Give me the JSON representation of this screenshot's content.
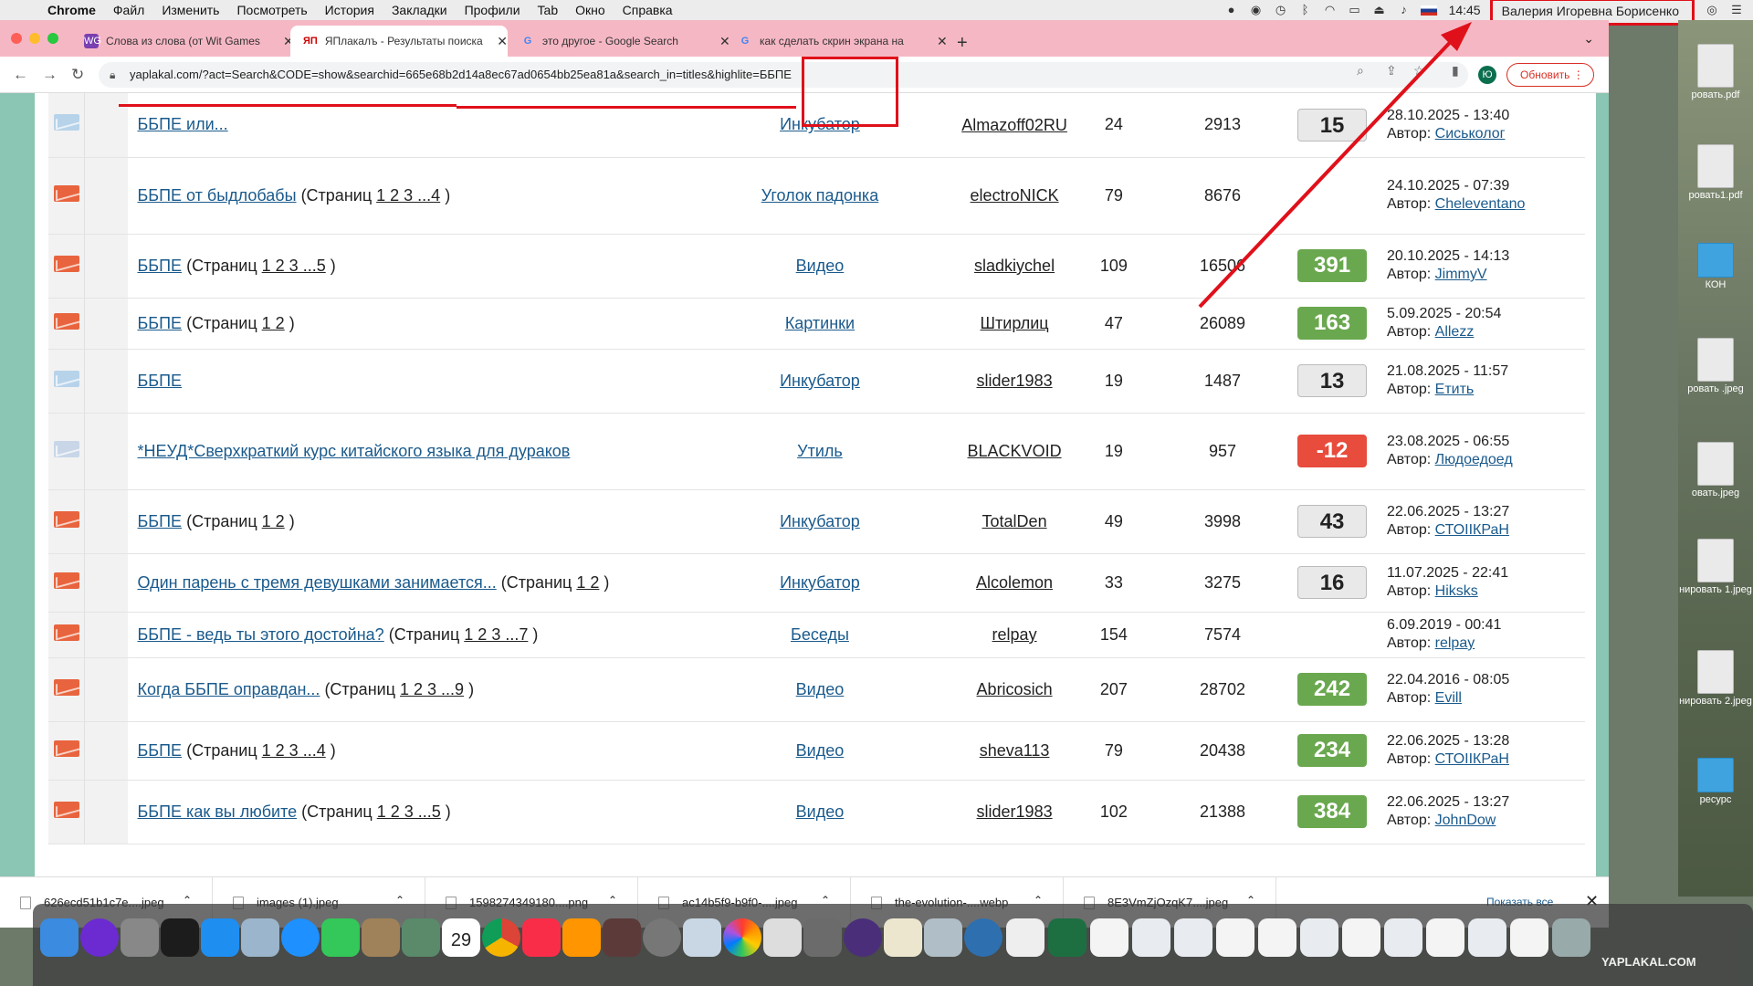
{
  "menubar": {
    "app": "Chrome",
    "items": [
      "Файл",
      "Изменить",
      "Посмотреть",
      "История",
      "Закладки",
      "Профили",
      "Tab",
      "Окно",
      "Справка"
    ],
    "clock": "14:45",
    "user": "Валерия Игоревна Борисенко"
  },
  "tabs": [
    {
      "title": "Слова из слова (от Wit Games",
      "favicon": "WG"
    },
    {
      "title": "ЯПлакалъ - Результаты поиска",
      "favicon": "ЯП"
    },
    {
      "title": "это другое - Google Search",
      "favicon": "G"
    },
    {
      "title": "как сделать скрин экрана на",
      "favicon": "G"
    }
  ],
  "toolbar": {
    "url": "yaplakal.com/?act=Search&CODE=show&searchid=665e68b2d14a8ec67ad0654bb25ea81a&search_in=titles&highlite=ББПЕ",
    "update_label": "Обновить",
    "profile_initial": "Ю"
  },
  "results": [
    {
      "icon": "env-blue",
      "title": "ББПЕ или...",
      "pages": "",
      "forum": "Инкубатор",
      "author": "Almazoff02RU",
      "replies": "24",
      "views": "2913",
      "score": "15",
      "score_style": "grey",
      "date": "28.10.2025 - 13:40",
      "last_label": "Автор:",
      "last_author": "Сиськолог"
    },
    {
      "icon": "env-red",
      "title": "ББПЕ от быдлобабы",
      "pages": "1 2 3 ...4",
      "forum": "Уголок падонка",
      "author": "electroNICK",
      "replies": "79",
      "views": "8676",
      "score": "",
      "score_style": "none",
      "date": "24.10.2025 - 07:39",
      "last_label": "Автор:",
      "last_author": "Cheleventano"
    },
    {
      "icon": "env-red",
      "title": "ББПЕ",
      "pages": "1 2 3 ...5",
      "forum": "Видео",
      "author": "sladkiychel",
      "replies": "109",
      "views": "16506",
      "score": "391",
      "score_style": "green",
      "date": "20.10.2025 - 14:13",
      "last_label": "Автор:",
      "last_author": "JimmyV"
    },
    {
      "icon": "env-red",
      "title": "ББПЕ",
      "pages": "1 2",
      "forum": "Картинки",
      "author": "Штирлиц",
      "replies": "47",
      "views": "26089",
      "score": "163",
      "score_style": "green",
      "date": "5.09.2025 - 20:54",
      "last_label": "Автор:",
      "last_author": "Allezz"
    },
    {
      "icon": "env-blue",
      "title": "ББПЕ",
      "pages": "",
      "forum": "Инкубатор",
      "author": "slider1983",
      "replies": "19",
      "views": "1487",
      "score": "13",
      "score_style": "grey",
      "date": "21.08.2025 - 11:57",
      "last_label": "Автор:",
      "last_author": "Етить"
    },
    {
      "icon": "poll",
      "title": "*НЕУД*Сверхкраткий курс китайского языка для дураков",
      "pages": "",
      "forum": "Утиль",
      "author": "BLACKVOID",
      "replies": "19",
      "views": "957",
      "score": "-12",
      "score_style": "red",
      "date": "23.08.2025 - 06:55",
      "last_label": "Автор:",
      "last_author": "Людоедоед"
    },
    {
      "icon": "env-red",
      "title": "ББПЕ",
      "pages": "1 2",
      "forum": "Инкубатор",
      "author": "TotalDen",
      "replies": "49",
      "views": "3998",
      "score": "43",
      "score_style": "grey",
      "date": "22.06.2025 - 13:27",
      "last_label": "Автор:",
      "last_author": "СТОIIКРаН"
    },
    {
      "icon": "env-red",
      "title": "Один парень с тремя девушками занимается...",
      "pages": "1 2",
      "forum": "Инкубатор",
      "author": "Alcolemon",
      "replies": "33",
      "views": "3275",
      "score": "16",
      "score_style": "grey",
      "date": "11.07.2025 - 22:41",
      "last_label": "Автор:",
      "last_author": "Hiksks"
    },
    {
      "icon": "env-red",
      "title": "ББПЕ - ведь ты этого достойна?",
      "pages": "1 2 3 ...7",
      "forum": "Беседы",
      "author": "relpay",
      "replies": "154",
      "views": "7574",
      "score": "",
      "score_style": "none",
      "date": "6.09.2019 - 00:41",
      "last_label": "Автор:",
      "last_author": "relpay"
    },
    {
      "icon": "env-red",
      "title": "Когда ББПЕ оправдан...",
      "pages": "1 2 3 ...9",
      "forum": "Видео",
      "author": "Abricosich",
      "replies": "207",
      "views": "28702",
      "score": "242",
      "score_style": "green",
      "date": "22.04.2016 - 08:05",
      "last_label": "Автор:",
      "last_author": "Evill"
    },
    {
      "icon": "env-red",
      "title": "ББПЕ",
      "pages": "1 2 3 ...4",
      "forum": "Видео",
      "author": "sheva113",
      "replies": "79",
      "views": "20438",
      "score": "234",
      "score_style": "green",
      "date": "22.06.2025 - 13:28",
      "last_label": "Автор:",
      "last_author": "СТОIIКРаН"
    },
    {
      "icon": "env-red",
      "title": "ББПЕ как вы любите",
      "pages": "1 2 3 ...5",
      "forum": "Видео",
      "author": "slider1983",
      "replies": "102",
      "views": "21388",
      "score": "384",
      "score_style": "green",
      "date": "22.06.2025 - 13:27",
      "last_label": "Автор:",
      "last_author": "JohnDow"
    }
  ],
  "pages_prefix": "(Страниц ",
  "pages_suffix": " )",
  "downloads": [
    "626ecd51b1c7e....jpeg",
    "images (1).jpeg",
    "1598274349180....png",
    "ac14b5f9-b9f0-....jpeg",
    "the-evolution-....webp",
    "8E3VmZjOzqK7....jpeg"
  ],
  "shelf": {
    "show_all": "Показать все"
  },
  "desktop_items": [
    "ровать.pdf",
    "ровать1.pdf",
    "КОН",
    "ровать\n.jpeg",
    "овать.jpeg",
    "нировать\n1.jpeg",
    "нировать\n2.jpeg",
    "ресурс"
  ],
  "dock": {
    "watermark": "YAPLAKAL.COM",
    "calendar_day": "29"
  },
  "colors": {
    "accent_red": "#e0101a",
    "score_green": "#6aa84f",
    "score_red": "#e74c3c",
    "tabbar_pink": "#f6b7c4",
    "link_blue": "#1a5a8c"
  }
}
